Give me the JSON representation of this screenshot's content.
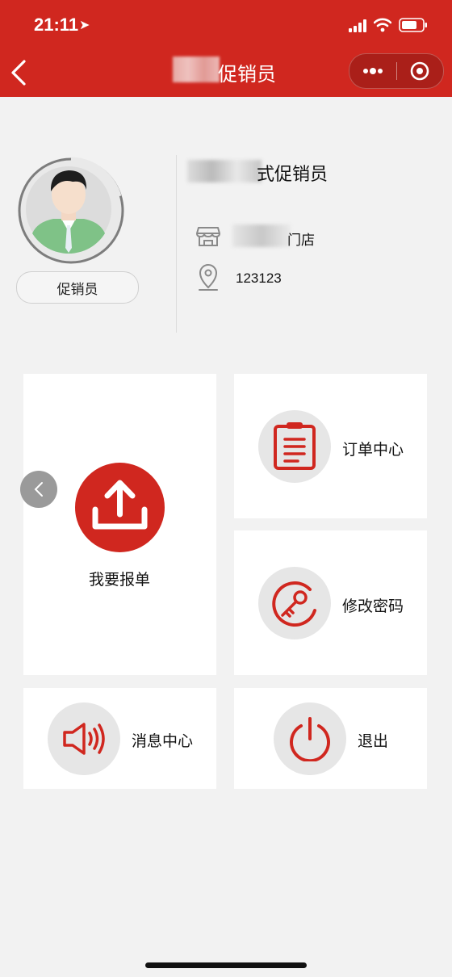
{
  "status_bar": {
    "time": "21:11"
  },
  "header": {
    "title": "促销员"
  },
  "profile": {
    "role_badge": "促销员",
    "name_suffix": "式促销员",
    "store_suffix": "门店",
    "location_value": "123123"
  },
  "cards": {
    "report": {
      "label": "我要报单"
    },
    "orders": {
      "label": "订单中心"
    },
    "password": {
      "label": "修改密码"
    },
    "messages": {
      "label": "消息中心"
    },
    "logout": {
      "label": "退出"
    }
  },
  "colors": {
    "brand_red": "#d0271f",
    "background": "#f2f2f2",
    "icon_bg": "#e6e6e6"
  }
}
